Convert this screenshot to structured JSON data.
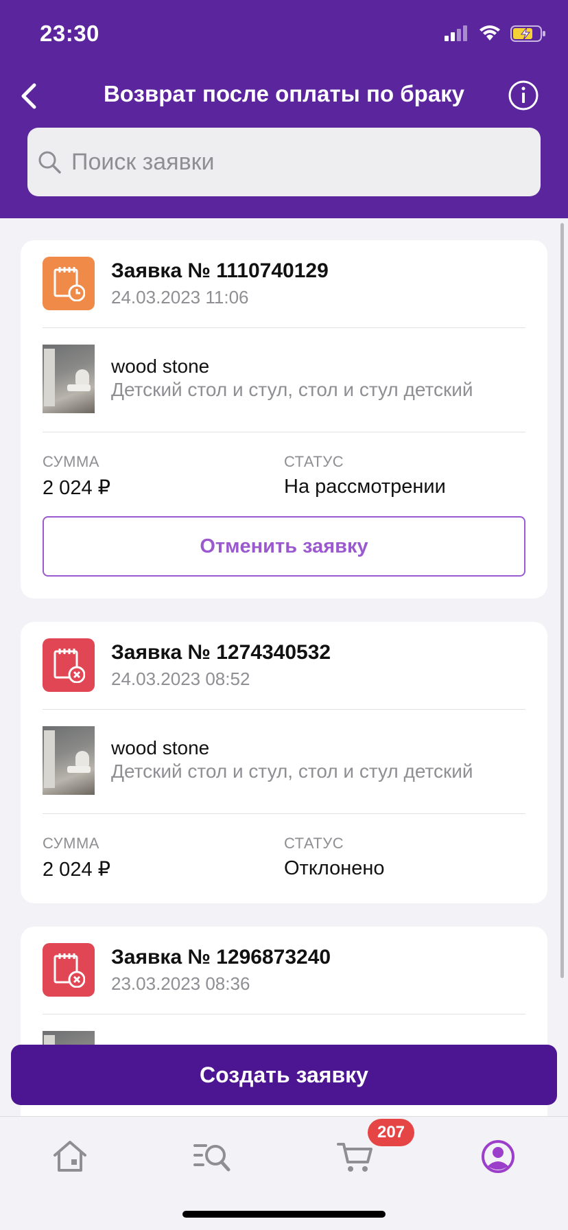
{
  "status_bar": {
    "time": "23:30"
  },
  "header": {
    "title": "Возврат после оплаты по браку",
    "search_placeholder": "Поиск заявки"
  },
  "labels": {
    "sum": "СУММА",
    "status": "СТАТУС"
  },
  "requests": [
    {
      "number": "Заявка № 1110740129",
      "date": "24.03.2023 11:06",
      "icon": "clock-document-icon",
      "brand": "wood stone",
      "product": "Детский стол и стул, стол и стул детский",
      "sum": "2 024 ₽",
      "status": "На рассмотрении",
      "action": "Отменить заявку"
    },
    {
      "number": "Заявка № 1274340532",
      "date": "24.03.2023 08:52",
      "icon": "rejected-document-icon",
      "brand": "wood stone",
      "product": "Детский стол и стул, стол и стул детский",
      "sum": "2 024 ₽",
      "status": "Отклонено"
    },
    {
      "number": "Заявка № 1296873240",
      "date": "23.03.2023 08:36",
      "icon": "rejected-document-icon"
    }
  ],
  "create_button": "Создать заявку",
  "tabbar": {
    "items": [
      "home-icon",
      "catalog-search-icon",
      "cart-icon",
      "profile-icon"
    ],
    "cart_badge": "207",
    "active": "profile-icon"
  },
  "colors": {
    "header": "#5b259e",
    "primary_button": "#4c1591",
    "accent": "#9b59d0",
    "pending": "#f08a48",
    "rejected": "#e04653",
    "badge": "#e54545"
  }
}
